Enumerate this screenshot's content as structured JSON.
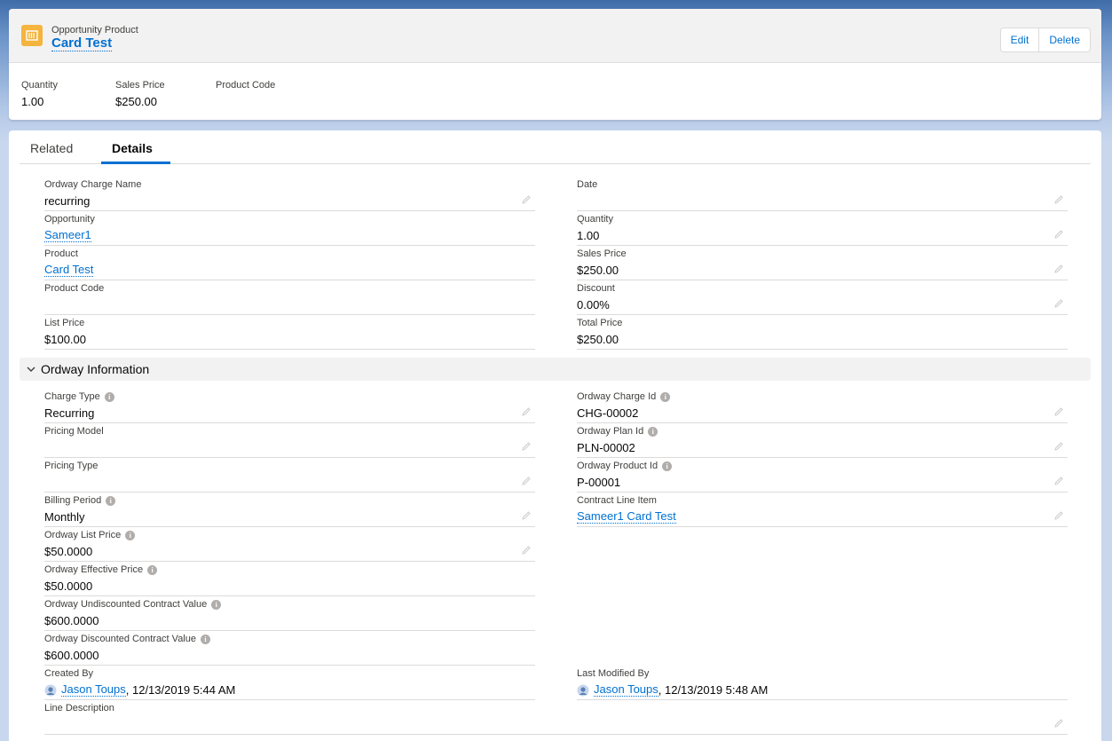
{
  "header": {
    "object_type": "Opportunity Product",
    "record_name": "Card Test",
    "icon": "price-book-icon",
    "buttons": {
      "edit": "Edit",
      "delete": "Delete"
    }
  },
  "highlights": [
    {
      "label": "Quantity",
      "value": "1.00"
    },
    {
      "label": "Sales Price",
      "value": "$250.00"
    },
    {
      "label": "Product Code",
      "value": ""
    }
  ],
  "tabs": {
    "related": "Related",
    "details": "Details",
    "active": "Details"
  },
  "details": {
    "left": [
      {
        "label": "Ordway Charge Name",
        "value": "recurring",
        "link": false,
        "editable": true
      },
      {
        "label": "Opportunity",
        "value": "Sameer1",
        "link": true,
        "editable": false
      },
      {
        "label": "Product",
        "value": "Card Test",
        "link": true,
        "editable": false
      },
      {
        "label": "Product Code",
        "value": "",
        "link": false,
        "editable": false
      },
      {
        "label": "List Price",
        "value": "$100.00",
        "link": false,
        "editable": false
      }
    ],
    "right": [
      {
        "label": "Date",
        "value": "",
        "link": false,
        "editable": true
      },
      {
        "label": "Quantity",
        "value": "1.00",
        "link": false,
        "editable": true
      },
      {
        "label": "Sales Price",
        "value": "$250.00",
        "link": false,
        "editable": true
      },
      {
        "label": "Discount",
        "value": "0.00%",
        "link": false,
        "editable": true
      },
      {
        "label": "Total Price",
        "value": "$250.00",
        "link": false,
        "editable": false
      }
    ]
  },
  "ordway_section": {
    "title": "Ordway Information",
    "left": [
      {
        "label": "Charge Type",
        "value": "Recurring",
        "info": true,
        "editable": true
      },
      {
        "label": "Pricing Model",
        "value": "",
        "info": false,
        "editable": true
      },
      {
        "label": "Pricing Type",
        "value": "",
        "info": false,
        "editable": true
      },
      {
        "label": "Billing Period",
        "value": "Monthly",
        "info": true,
        "editable": true
      },
      {
        "label": "Ordway List Price",
        "value": "$50.0000",
        "info": true,
        "editable": true
      },
      {
        "label": "Ordway Effective Price",
        "value": "$50.0000",
        "info": true,
        "editable": false
      },
      {
        "label": "Ordway Undiscounted Contract Value",
        "value": "$600.0000",
        "info": true,
        "editable": false
      },
      {
        "label": "Ordway Discounted Contract Value",
        "value": "$600.0000",
        "info": true,
        "editable": false
      }
    ],
    "right": [
      {
        "label": "Ordway Charge Id",
        "value": "CHG-00002",
        "info": true,
        "editable": true,
        "link": false
      },
      {
        "label": "Ordway Plan Id",
        "value": "PLN-00002",
        "info": true,
        "editable": true,
        "link": false
      },
      {
        "label": "Ordway Product Id",
        "value": "P-00001",
        "info": true,
        "editable": true,
        "link": false
      },
      {
        "label": "Contract Line Item",
        "value": "Sameer1 Card Test",
        "info": false,
        "editable": true,
        "link": true
      }
    ]
  },
  "system": {
    "created_by": {
      "label": "Created By",
      "user": "Jason Toups",
      "date": ", 12/13/2019 5:44 AM"
    },
    "last_modified_by": {
      "label": "Last Modified By",
      "user": "Jason Toups",
      "date": ", 12/13/2019 5:48 AM"
    },
    "line_description": {
      "label": "Line Description",
      "value": ""
    }
  }
}
